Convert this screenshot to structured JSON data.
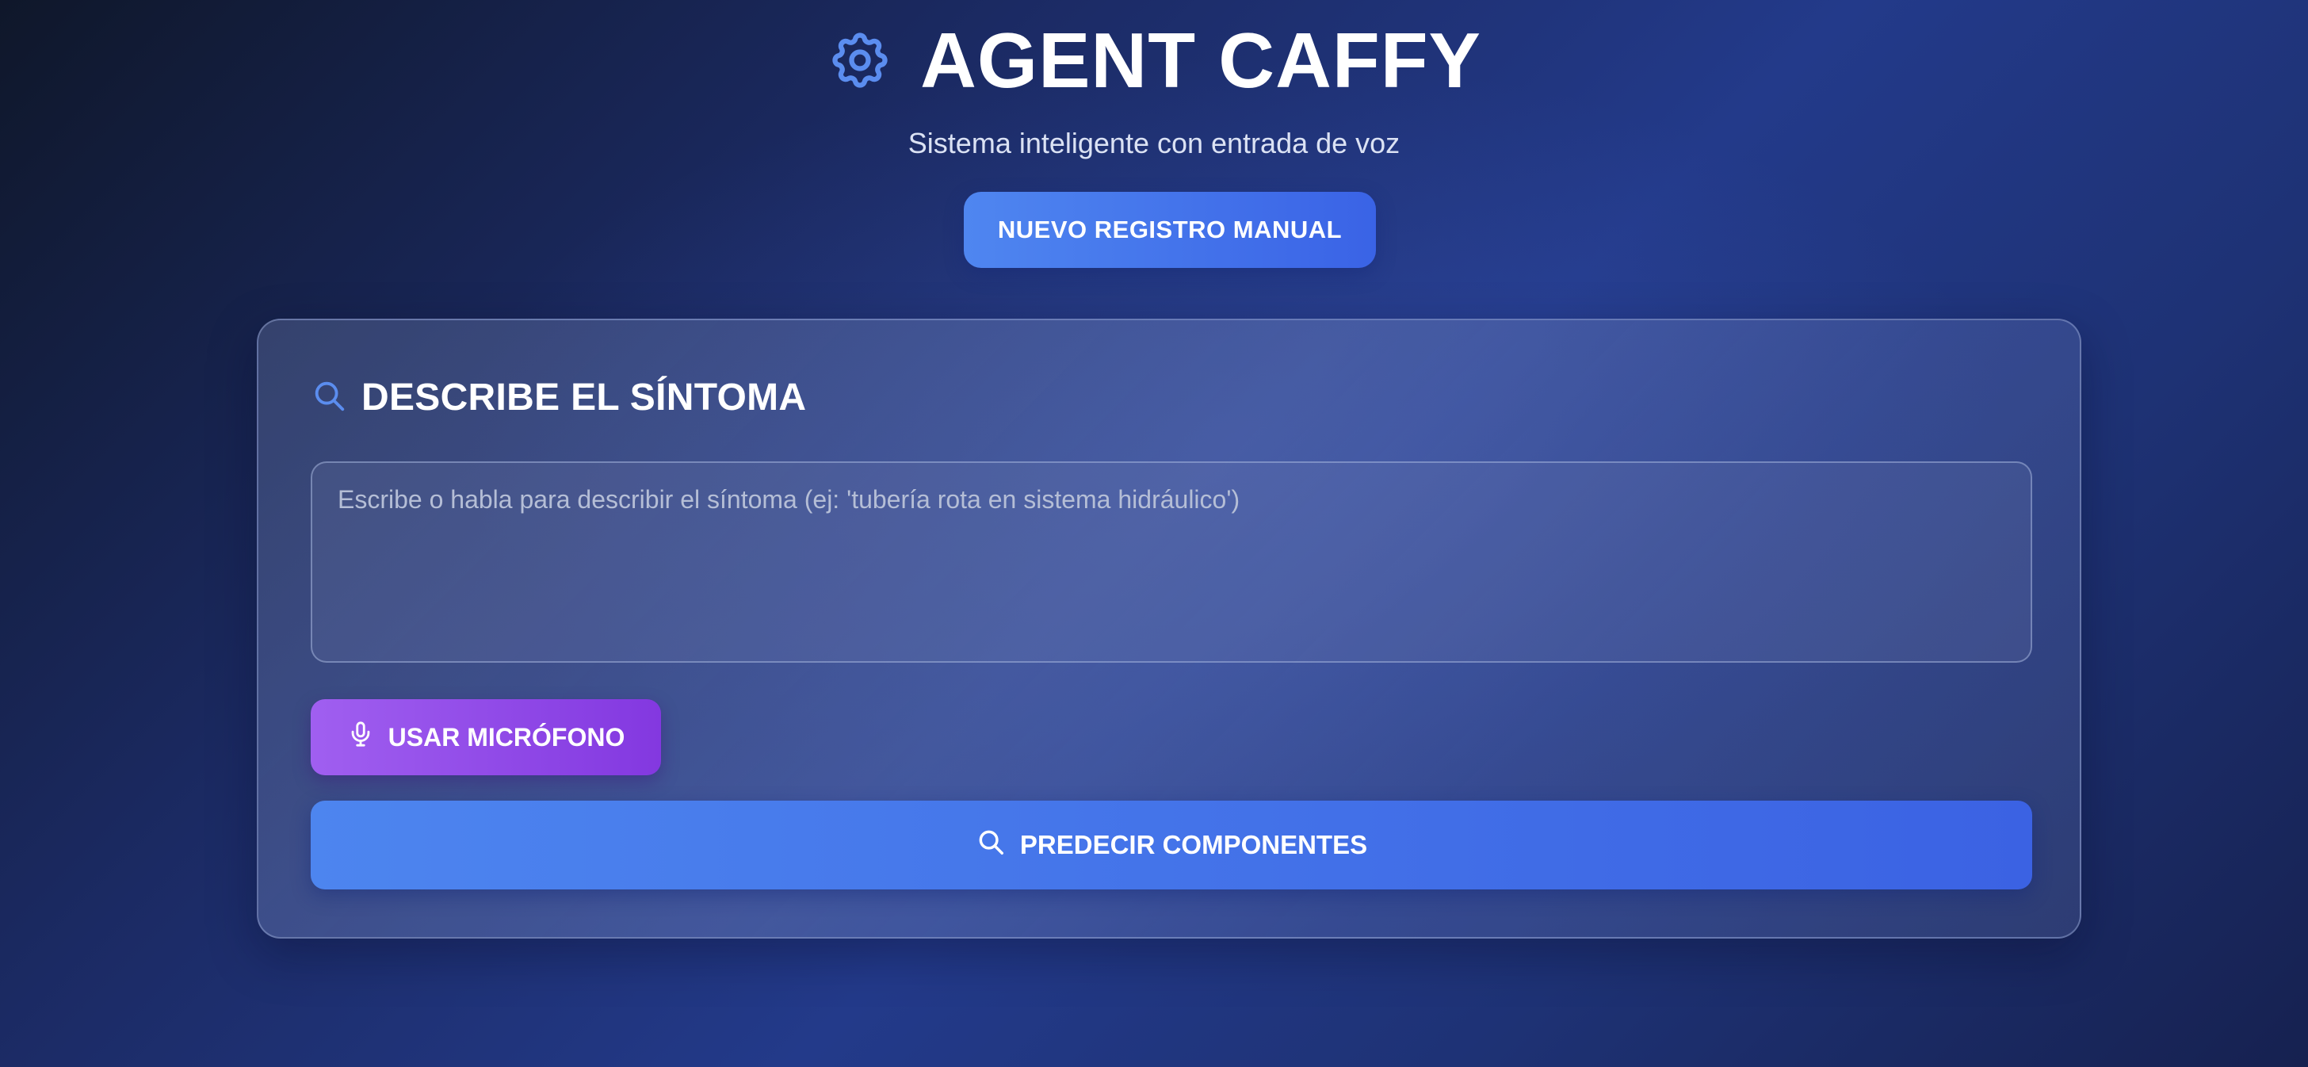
{
  "header": {
    "title": "AGENT CAFFY",
    "subtitle": "Sistema inteligente con entrada de voz",
    "logo_icon": "gear-icon",
    "manual_button_label": "NUEVO REGISTRO MANUAL"
  },
  "card": {
    "title": "DESCRIBE EL SÍNTOMA",
    "title_icon": "search-icon",
    "input": {
      "placeholder": "Escribe o habla para describir el síntoma (ej: 'tubería rota en sistema hidráulico')",
      "value": ""
    },
    "mic_button": {
      "label": "USAR MICRÓFONO",
      "icon": "microphone-icon"
    },
    "predict_button": {
      "label": "PREDECIR COMPONENTES",
      "icon": "search-icon"
    }
  },
  "colors": {
    "accent_blue": "#4a7bec",
    "accent_purple": "#9a52ec",
    "icon_blue": "#5b8def",
    "background_dark": "#0f172a"
  }
}
